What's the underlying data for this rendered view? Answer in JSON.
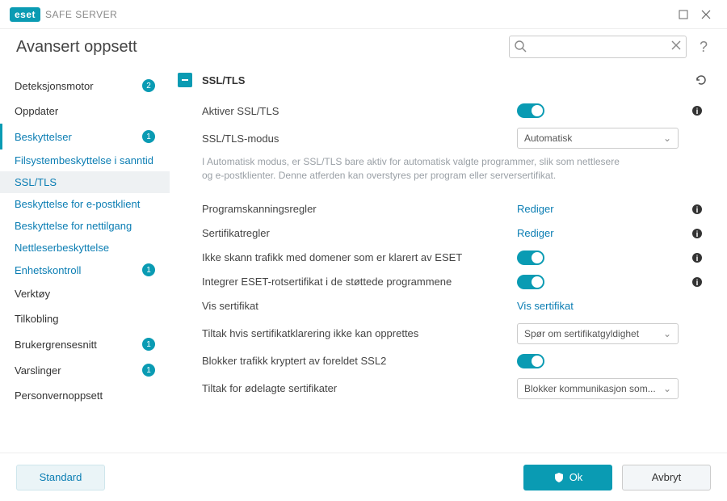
{
  "titlebar": {
    "brand_badge": "eset",
    "brand_text": "SAFE SERVER"
  },
  "header": {
    "title": "Avansert oppsett",
    "search_placeholder": ""
  },
  "sidebar": {
    "items": [
      {
        "label": "Deteksjonsmotor",
        "badge": "2"
      },
      {
        "label": "Oppdater"
      },
      {
        "label": "Beskyttelser",
        "badge": "1",
        "active_border": true
      },
      {
        "label": "Verktøy"
      },
      {
        "label": "Tilkobling"
      },
      {
        "label": "Brukergrensesnitt",
        "badge": "1"
      },
      {
        "label": "Varslinger",
        "badge": "1"
      },
      {
        "label": "Personvernoppsett"
      }
    ],
    "subs": [
      {
        "label": "Filsystembeskyttelse i sanntid"
      },
      {
        "label": "SSL/TLS",
        "active": true
      },
      {
        "label": "Beskyttelse for e-postklient"
      },
      {
        "label": "Beskyttelse for nettilgang"
      },
      {
        "label": "Nettleserbeskyttelse"
      },
      {
        "label": "Enhetskontroll",
        "badge": "1"
      }
    ]
  },
  "content": {
    "panel_title": "SSL/TLS",
    "enable_label": "Aktiver SSL/TLS",
    "mode_label": "SSL/TLS-modus",
    "mode_value": "Automatisk",
    "mode_desc": "I Automatisk modus, er SSL/TLS bare aktiv for automatisk valgte programmer, slik som nettlesere og e-postklienter. Denne atferden kan overstyres per program eller serversertifikat.",
    "app_rules_label": "Programskanningsregler",
    "app_rules_link": "Rediger",
    "cert_rules_label": "Sertifikatregler",
    "cert_rules_link": "Rediger",
    "trusted_domains_label": "Ikke skann trafikk med domener som er klarert av ESET",
    "integrate_cert_label": "Integrer ESET-rotsertifikat i de støttede programmene",
    "view_cert_label": "Vis sertifikat",
    "view_cert_link": "Vis sertifikat",
    "trust_action_label": "Tiltak hvis sertifikatklarering ikke kan opprettes",
    "trust_action_value": "Spør om sertifikatgyldighet",
    "block_ssl2_label": "Blokker trafikk kryptert av foreldet SSL2",
    "corrupt_cert_label": "Tiltak for ødelagte sertifikater",
    "corrupt_cert_value": "Blokker kommunikasjon som..."
  },
  "footer": {
    "default": "Standard",
    "ok": "Ok",
    "cancel": "Avbryt"
  }
}
